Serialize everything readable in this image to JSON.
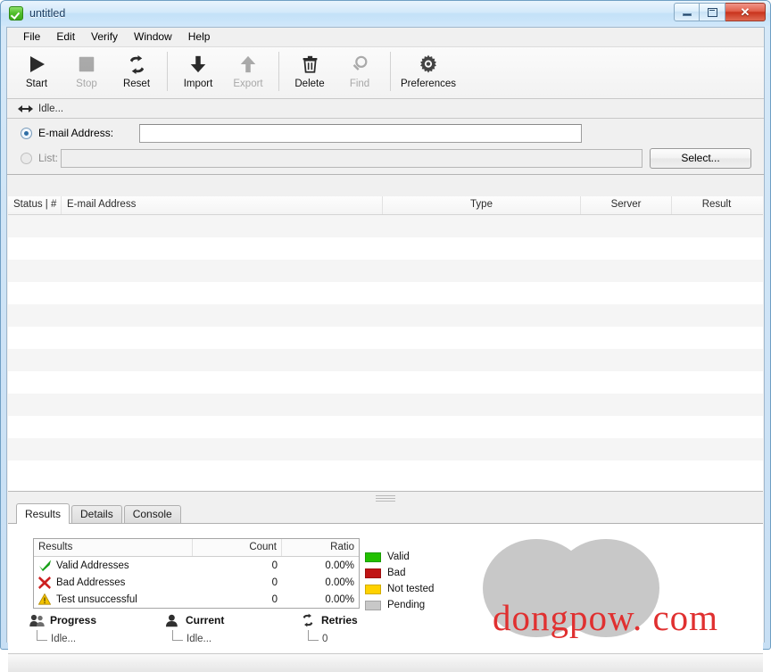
{
  "window": {
    "title": "untitled",
    "app_icon": "check-badge-icon",
    "controls": {
      "minimize": "minimize-icon",
      "maximize": "maximize-icon",
      "close": "close-icon"
    }
  },
  "menubar": {
    "items": [
      {
        "label": "File"
      },
      {
        "label": "Edit"
      },
      {
        "label": "Verify"
      },
      {
        "label": "Window"
      },
      {
        "label": "Help"
      }
    ]
  },
  "toolbar": {
    "buttons": [
      {
        "label": "Start",
        "icon": "play-icon",
        "enabled": true
      },
      {
        "label": "Stop",
        "icon": "stop-square-icon",
        "enabled": false
      },
      {
        "label": "Reset",
        "icon": "refresh-icon",
        "enabled": true
      },
      {
        "label": "Import",
        "icon": "arrow-down-icon",
        "enabled": true
      },
      {
        "label": "Export",
        "icon": "arrow-up-icon",
        "enabled": false
      },
      {
        "label": "Delete",
        "icon": "trash-icon",
        "enabled": true
      },
      {
        "label": "Find",
        "icon": "magnifier-icon",
        "enabled": false
      },
      {
        "label": "Preferences",
        "icon": "gear-icon",
        "enabled": true
      }
    ]
  },
  "status_strip": {
    "icon": "left-right-arrows-icon",
    "text": "Idle..."
  },
  "input_panel": {
    "email": {
      "radio_label": "E-mail Address:",
      "selected": true,
      "value": "",
      "placeholder": ""
    },
    "list": {
      "radio_label": "List:",
      "selected": false,
      "value": "",
      "placeholder": "",
      "select_button": "Select..."
    }
  },
  "main_table": {
    "columns": [
      {
        "label": "Status | #"
      },
      {
        "label": "E-mail Address"
      },
      {
        "label": "Type"
      },
      {
        "label": "Server"
      },
      {
        "label": "Result"
      }
    ],
    "rows": []
  },
  "tabs": [
    {
      "label": "Results",
      "active": true
    },
    {
      "label": "Details",
      "active": false
    },
    {
      "label": "Console",
      "active": false
    }
  ],
  "results_panel": {
    "table": {
      "columns": [
        "Results",
        "Count",
        "Ratio"
      ],
      "rows": [
        {
          "icon": "green-check-icon",
          "label": "Valid Addresses",
          "count": "0",
          "ratio": "0.00%"
        },
        {
          "icon": "red-x-icon",
          "label": "Bad Addresses",
          "count": "0",
          "ratio": "0.00%"
        },
        {
          "icon": "warning-triangle-icon",
          "label": "Test unsuccessful",
          "count": "0",
          "ratio": "0.00%"
        }
      ]
    },
    "legend": [
      {
        "label": "Valid",
        "color": "#22c000"
      },
      {
        "label": "Bad",
        "color": "#c01414"
      },
      {
        "label": "Not tested",
        "color": "#ffd200"
      },
      {
        "label": "Pending",
        "color": "#c8c8c8"
      }
    ],
    "metrics": [
      {
        "name": "Progress",
        "icon": "users-icon",
        "value": "Idle..."
      },
      {
        "name": "Current",
        "icon": "user-icon",
        "value": "Idle..."
      },
      {
        "name": "Retries",
        "icon": "refresh-icon",
        "value": "0"
      }
    ]
  },
  "chart_data": {
    "type": "pie",
    "title": "",
    "categories": [
      "Valid",
      "Bad",
      "Not tested",
      "Pending"
    ],
    "values": [
      0,
      0,
      0,
      100
    ],
    "colors": [
      "#22c000",
      "#c01414",
      "#ffd200",
      "#c8c8c8"
    ],
    "legend": "left",
    "note": "All slices empty; chart renders fully as Pending (gray)."
  },
  "watermark": {
    "text": "dongpow. com",
    "color": "#e03030"
  }
}
